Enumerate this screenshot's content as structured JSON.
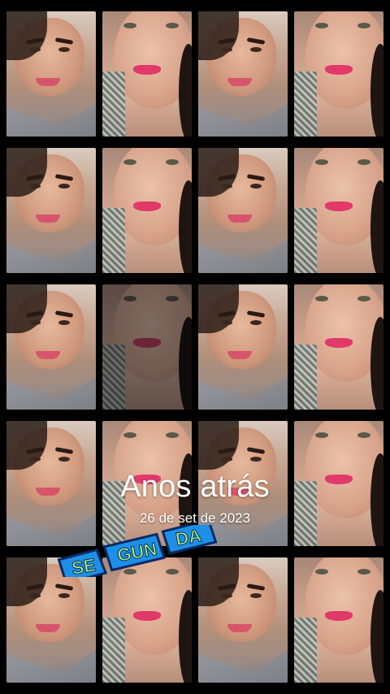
{
  "memory": {
    "title": "Anos atrás",
    "date": "26 de set de 2023"
  },
  "sticker": {
    "parts": [
      "SE",
      "GUN",
      "DA"
    ],
    "colors": {
      "fill": "#1e8fe6",
      "text": "#a8f07a",
      "outline": "#0b2a66"
    }
  },
  "grid": {
    "rows": 5,
    "columns": 4,
    "photos": [
      [
        "a",
        "b",
        "a",
        "b"
      ],
      [
        "a",
        "b",
        "a",
        "b"
      ],
      [
        "a",
        "b-dim",
        "a",
        "b"
      ],
      [
        "a",
        "b",
        "a",
        "b"
      ],
      [
        "a",
        "b",
        "a",
        "b"
      ]
    ]
  }
}
